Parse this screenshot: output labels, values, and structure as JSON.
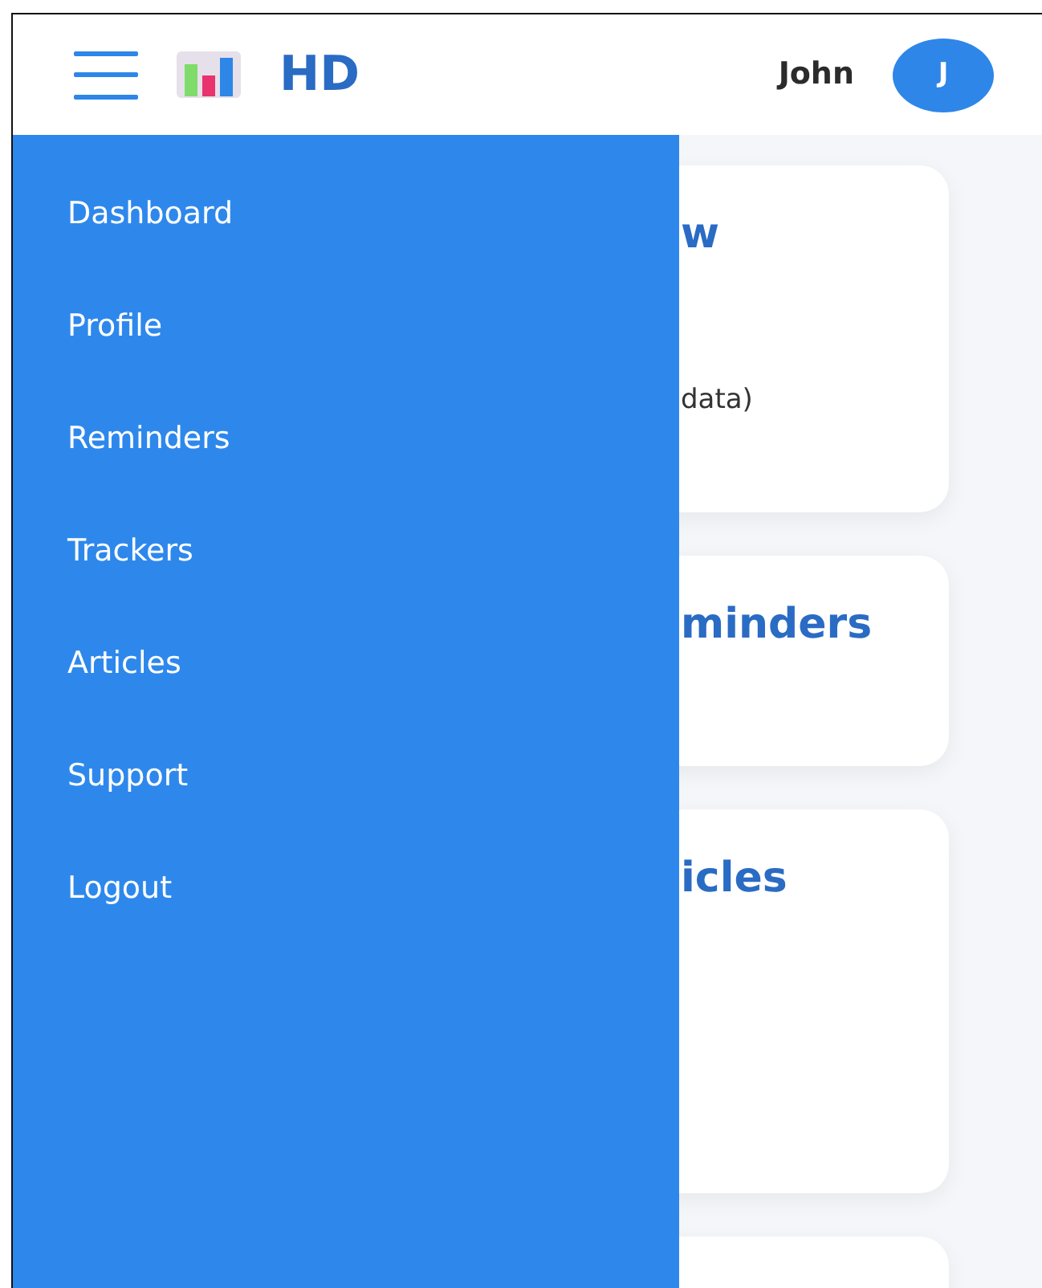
{
  "header": {
    "brand": "HD",
    "user_name": "John",
    "avatar_initial": "J"
  },
  "sidebar": {
    "open": true,
    "items": [
      {
        "label": "Dashboard"
      },
      {
        "label": "Profile"
      },
      {
        "label": "Reminders"
      },
      {
        "label": "Trackers"
      },
      {
        "label": "Articles"
      },
      {
        "label": "Support"
      },
      {
        "label": "Logout"
      }
    ]
  },
  "cards": [
    {
      "title": "w",
      "text": "data)"
    },
    {
      "title": "minders"
    },
    {
      "title": "icles"
    }
  ]
}
